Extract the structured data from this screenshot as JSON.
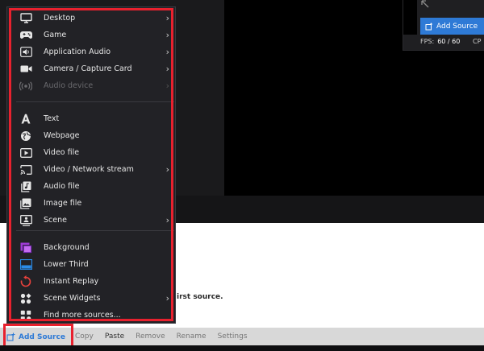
{
  "menu": {
    "groups": [
      [
        {
          "label": "Desktop",
          "icon": "monitor-icon",
          "submenu": true,
          "disabled": false
        },
        {
          "label": "Game",
          "icon": "gamepad-icon",
          "submenu": true,
          "disabled": false
        },
        {
          "label": "Application Audio",
          "icon": "speaker-icon",
          "submenu": true,
          "disabled": false
        },
        {
          "label": "Camera / Capture Card",
          "icon": "camera-icon",
          "submenu": true,
          "disabled": false
        },
        {
          "label": "Audio device",
          "icon": "broadcast-icon",
          "submenu": true,
          "disabled": true
        }
      ],
      [
        {
          "label": "Text",
          "icon": "text-icon",
          "submenu": false,
          "disabled": false
        },
        {
          "label": "Webpage",
          "icon": "globe-icon",
          "submenu": false,
          "disabled": false
        },
        {
          "label": "Video file",
          "icon": "video-file-icon",
          "submenu": false,
          "disabled": false
        },
        {
          "label": "Video / Network stream",
          "icon": "cast-icon",
          "submenu": true,
          "disabled": false
        },
        {
          "label": "Audio file",
          "icon": "audio-file-icon",
          "submenu": false,
          "disabled": false
        },
        {
          "label": "Image file",
          "icon": "image-file-icon",
          "submenu": false,
          "disabled": false
        },
        {
          "label": "Scene",
          "icon": "scene-icon",
          "submenu": true,
          "disabled": false
        }
      ],
      [
        {
          "label": "Background",
          "icon": "background-icon",
          "submenu": false,
          "disabled": false
        },
        {
          "label": "Lower Third",
          "icon": "lower-third-icon",
          "submenu": false,
          "disabled": false
        },
        {
          "label": "Instant Replay",
          "icon": "replay-icon",
          "submenu": false,
          "disabled": false
        },
        {
          "label": "Scene Widgets",
          "icon": "widgets-icon",
          "submenu": true,
          "disabled": false
        },
        {
          "label": "Find more sources...",
          "icon": "find-sources-icon",
          "submenu": false,
          "disabled": false
        }
      ]
    ]
  },
  "toolbar": {
    "add_source": "Add Source",
    "buttons": [
      {
        "label": "Copy",
        "enabled": false
      },
      {
        "label": "Paste",
        "enabled": true
      },
      {
        "label": "Remove",
        "enabled": false
      },
      {
        "label": "Rename",
        "enabled": false
      },
      {
        "label": "Settings",
        "enabled": false
      }
    ]
  },
  "mini_panel": {
    "add_source": "Add Source",
    "fps_label": "FPS:",
    "fps_value": "60 / 60",
    "cpu_label": "CP"
  },
  "canvas": {
    "hint_text": "irst source."
  },
  "colors": {
    "accent": "#2e7ad6",
    "highlight_frame": "#e8212e",
    "menu_bg": "#222226"
  }
}
